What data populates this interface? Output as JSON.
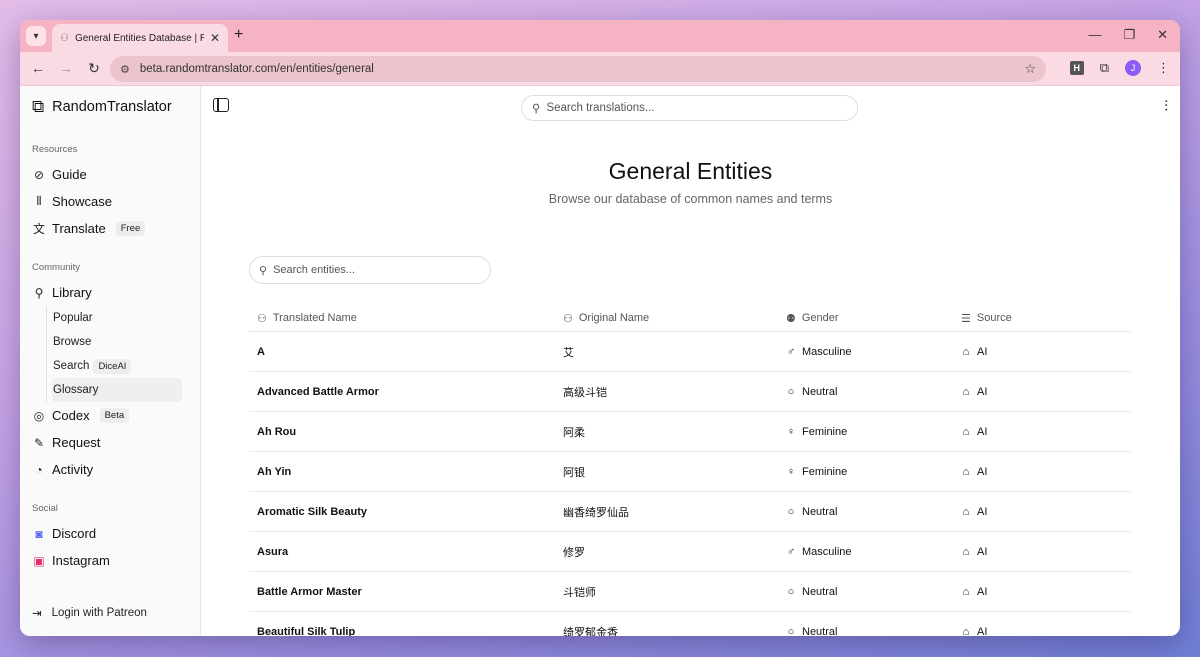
{
  "browser": {
    "tab_title": "General Entities Database | RandomTranslator",
    "url": "beta.randomtranslator.com/en/entities/general",
    "profile_initial": "J",
    "ext_badge": "H"
  },
  "sidebar": {
    "brand": "RandomTranslator",
    "resources_label": "Resources",
    "guide": "Guide",
    "showcase": "Showcase",
    "translate": "Translate",
    "translate_badge": "Free",
    "community_label": "Community",
    "library": "Library",
    "popular": "Popular",
    "browse": "Browse",
    "search": "Search",
    "search_badge": "DiceAI",
    "glossary": "Glossary",
    "codex": "Codex",
    "codex_badge": "Beta",
    "request": "Request",
    "activity": "Activity",
    "social_label": "Social",
    "discord": "Discord",
    "instagram": "Instagram",
    "login": "Login with Patreon"
  },
  "header": {
    "search_placeholder": "Search translations..."
  },
  "page": {
    "title": "General Entities",
    "subtitle": "Browse our database of common names and terms",
    "entity_search_placeholder": "Search entities..."
  },
  "table": {
    "headers": {
      "translated": "Translated Name",
      "original": "Original Name",
      "gender": "Gender",
      "source": "Source"
    },
    "rows": [
      {
        "translated": "A",
        "original": "艾",
        "gender": "Masculine",
        "source": "AI"
      },
      {
        "translated": "Advanced Battle Armor",
        "original": "高级斗铠",
        "gender": "Neutral",
        "source": "AI"
      },
      {
        "translated": "Ah Rou",
        "original": "阿柔",
        "gender": "Feminine",
        "source": "AI"
      },
      {
        "translated": "Ah Yin",
        "original": "阿银",
        "gender": "Feminine",
        "source": "AI"
      },
      {
        "translated": "Aromatic Silk Beauty",
        "original": "幽香绮罗仙品",
        "gender": "Neutral",
        "source": "AI"
      },
      {
        "translated": "Asura",
        "original": "修罗",
        "gender": "Masculine",
        "source": "AI"
      },
      {
        "translated": "Battle Armor Master",
        "original": "斗铠师",
        "gender": "Neutral",
        "source": "AI"
      },
      {
        "translated": "Beautiful Silk Tulip",
        "original": "绮罗郁金香",
        "gender": "Neutral",
        "source": "AI"
      }
    ]
  },
  "colors": {
    "tab_strip": "#f6b3c4",
    "toolbar": "#fbdbe3",
    "discord": "#5865f2",
    "instagram": "#e1306c"
  }
}
